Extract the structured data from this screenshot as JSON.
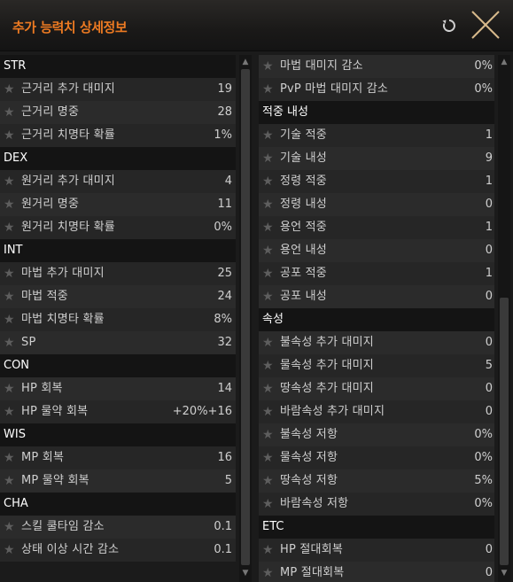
{
  "window": {
    "title": "추가 능력치 상세정보"
  },
  "colors": {
    "accent": "#ec7a22"
  },
  "icons": {
    "reset": "refresh-icon",
    "close": "close-icon",
    "star": "star-icon"
  },
  "left": {
    "sections": [
      {
        "header": "STR",
        "rows": [
          {
            "label": "근거리 추가 대미지",
            "value": "19"
          },
          {
            "label": "근거리 명중",
            "value": "28"
          },
          {
            "label": "근거리 치명타 확률",
            "value": "1%"
          }
        ]
      },
      {
        "header": "DEX",
        "rows": [
          {
            "label": "원거리 추가 대미지",
            "value": "4"
          },
          {
            "label": "원거리 명중",
            "value": "11"
          },
          {
            "label": "원거리 치명타 확률",
            "value": "0%"
          }
        ]
      },
      {
        "header": "INT",
        "rows": [
          {
            "label": "마법 추가 대미지",
            "value": "25"
          },
          {
            "label": "마법 적중",
            "value": "24"
          },
          {
            "label": "마법 치명타 확률",
            "value": "8%"
          },
          {
            "label": "SP",
            "value": "32"
          }
        ]
      },
      {
        "header": "CON",
        "rows": [
          {
            "label": "HP 회복",
            "value": "14"
          },
          {
            "label": "HP 물약 회복",
            "value": "+20%+16"
          }
        ]
      },
      {
        "header": "WIS",
        "rows": [
          {
            "label": "MP 회복",
            "value": "16"
          },
          {
            "label": "MP 물약 회복",
            "value": "5"
          }
        ]
      },
      {
        "header": "CHA",
        "rows": [
          {
            "label": "스킬 쿨타임 감소",
            "value": "0.1"
          },
          {
            "label": "상태 이상 시간 감소",
            "value": "0.1"
          }
        ]
      }
    ]
  },
  "right": {
    "top_rows": [
      {
        "label": "마법 대미지 감소",
        "value": "0%"
      },
      {
        "label": "PvP 마법 대미지 감소",
        "value": "0%"
      }
    ],
    "sections": [
      {
        "header": "적중 내성",
        "rows": [
          {
            "label": "기술 적중",
            "value": "1"
          },
          {
            "label": "기술 내성",
            "value": "9"
          },
          {
            "label": "정령 적중",
            "value": "1"
          },
          {
            "label": "정령 내성",
            "value": "0"
          },
          {
            "label": "용언 적중",
            "value": "1"
          },
          {
            "label": "용언 내성",
            "value": "0"
          },
          {
            "label": "공포 적중",
            "value": "1"
          },
          {
            "label": "공포 내성",
            "value": "0"
          }
        ]
      },
      {
        "header": "속성",
        "rows": [
          {
            "label": "불속성 추가 대미지",
            "value": "0"
          },
          {
            "label": "물속성 추가 대미지",
            "value": "5"
          },
          {
            "label": "땅속성 추가 대미지",
            "value": "0"
          },
          {
            "label": "바람속성 추가 대미지",
            "value": "0"
          },
          {
            "label": "불속성 저항",
            "value": "0%"
          },
          {
            "label": "물속성 저항",
            "value": "0%"
          },
          {
            "label": "땅속성 저항",
            "value": "5%"
          },
          {
            "label": "바람속성 저항",
            "value": "0%"
          }
        ]
      },
      {
        "header": "ETC",
        "rows": [
          {
            "label": "HP 절대회복",
            "value": "0"
          },
          {
            "label": "MP 절대회복",
            "value": "0"
          }
        ]
      }
    ]
  }
}
